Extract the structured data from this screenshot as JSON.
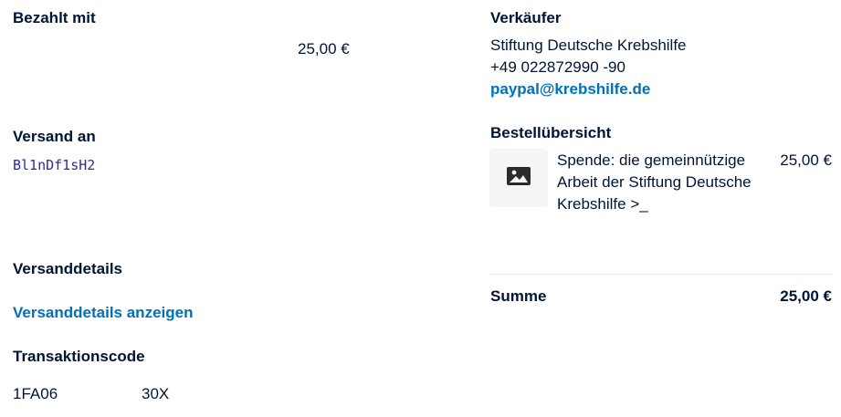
{
  "paid_with": {
    "heading": "Bezahlt mit",
    "amount": "25,00 €"
  },
  "shipping_to": {
    "heading": "Versand an",
    "value": "Bl1nDf1sH2"
  },
  "shipping_details": {
    "heading": "Versanddetails",
    "link": "Versanddetails anzeigen"
  },
  "transaction": {
    "heading": "Transaktionscode",
    "code_part1": "1FA06",
    "code_part2": "30X"
  },
  "seller": {
    "heading": "Verkäufer",
    "name": "Stiftung Deutsche Krebshilfe",
    "phone": "+49 022872990 -90",
    "email": "paypal@krebshilfe.de"
  },
  "order_summary": {
    "heading": "Bestellübersicht",
    "item": {
      "icon": "image-placeholder-icon",
      "title": "Spende: die gemeinnützige Arbeit der Stiftung Deutsche Krebshilfe >_",
      "price": "25,00 €"
    },
    "total_label": "Summe",
    "total_value": "25,00 €"
  },
  "colors": {
    "text": "#001435",
    "link": "#0070ba",
    "thumbnail_bg": "#f5f5f3",
    "divider": "#e6e7e9"
  }
}
